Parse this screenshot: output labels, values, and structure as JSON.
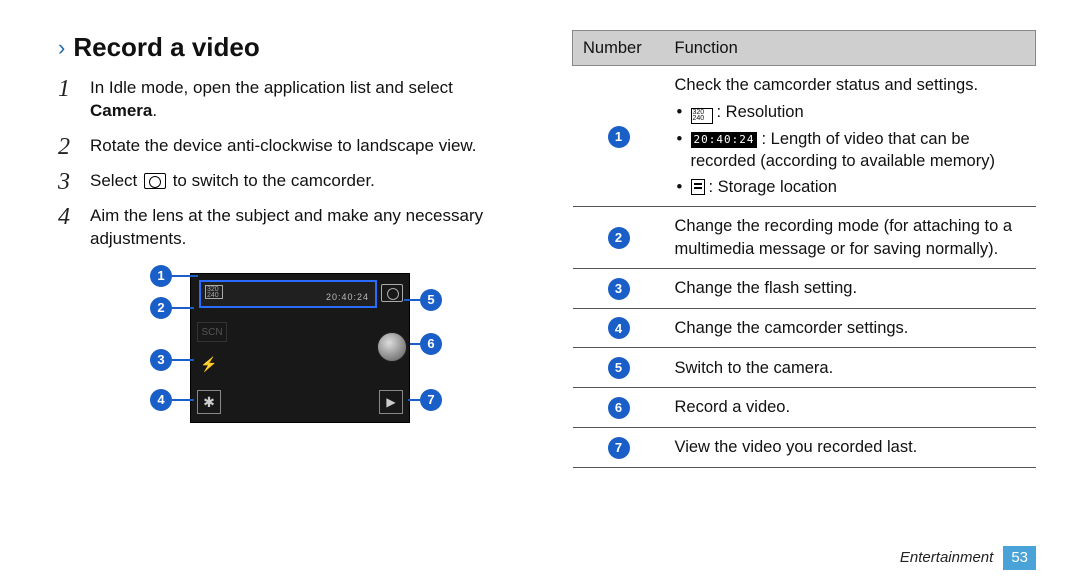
{
  "heading": "Record a video",
  "steps": [
    {
      "pre": "In Idle mode, open the application list and select ",
      "bold": "Camera",
      "post": "."
    },
    {
      "pre": "Rotate the device anti-clockwise to landscape view."
    },
    {
      "pre": "Select ",
      "icon": "camera",
      "post": " to switch to the camcorder."
    },
    {
      "pre": "Aim the lens at the subject and make any necessary adjustments."
    }
  ],
  "diagram": {
    "resolution_label": "320\n240",
    "time_label": "20:40:24",
    "scn_label": "SCN"
  },
  "table": {
    "headers": {
      "number": "Number",
      "function": "Function"
    },
    "rows": [
      {
        "n": "1",
        "lead": "Check the camcorder status and settings.",
        "bullets": [
          {
            "icon": "res",
            "text": ": Resolution"
          },
          {
            "icon": "time",
            "text": ": Length of video that can be recorded (according to available memory)"
          },
          {
            "icon": "store",
            "text": ": Storage location"
          }
        ]
      },
      {
        "n": "2",
        "lead": "Change the recording mode (for attaching to a multimedia message or for saving normally)."
      },
      {
        "n": "3",
        "lead": "Change the flash setting."
      },
      {
        "n": "4",
        "lead": "Change the camcorder settings."
      },
      {
        "n": "5",
        "lead": "Switch to the camera."
      },
      {
        "n": "6",
        "lead": "Record a video."
      },
      {
        "n": "7",
        "lead": "View the video you recorded last."
      }
    ]
  },
  "footer": {
    "section": "Entertainment",
    "page": "53"
  }
}
